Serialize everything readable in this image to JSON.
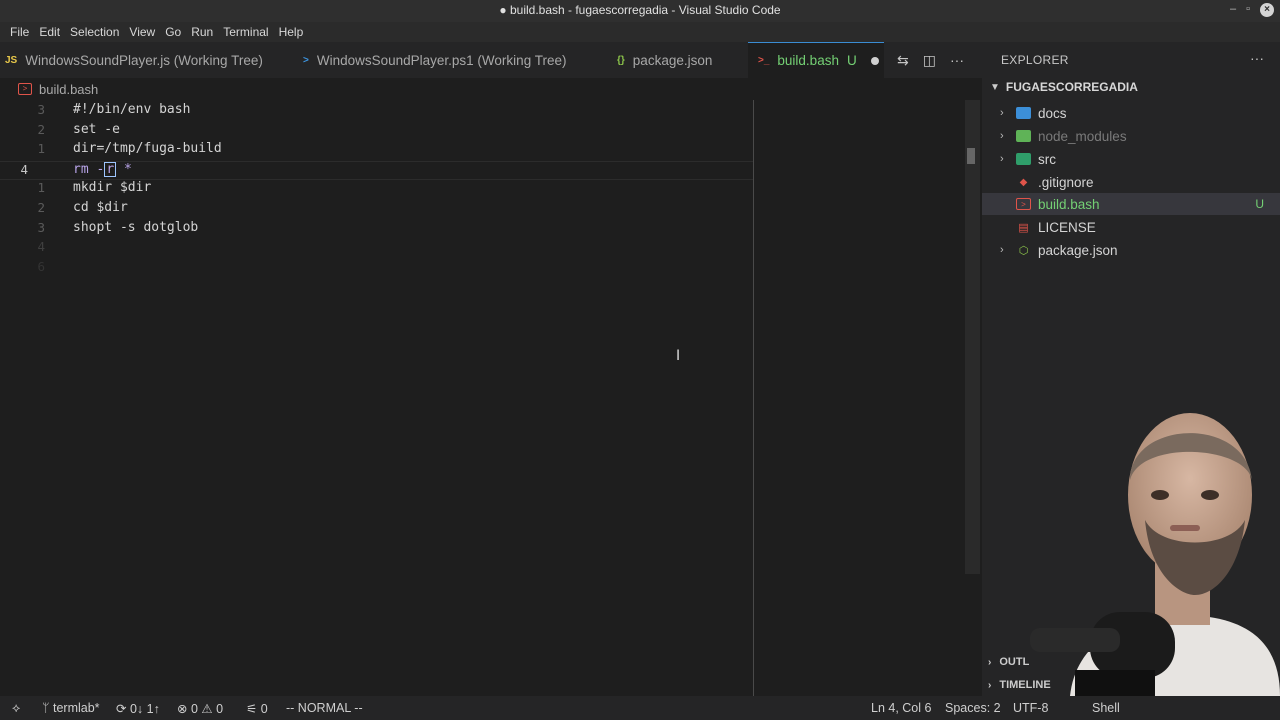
{
  "window": {
    "title": "● build.bash - fugaescorregadia - Visual Studio Code"
  },
  "menu": [
    "File",
    "Edit",
    "Selection",
    "View",
    "Go",
    "Run",
    "Terminal",
    "Help"
  ],
  "tabs": [
    {
      "label": "WindowsSoundPlayer.js (Working Tree)",
      "icon": "JS"
    },
    {
      "label": "WindowsSoundPlayer.ps1 (Working Tree)",
      "icon": ">"
    },
    {
      "label": "package.json",
      "icon": "{}"
    },
    {
      "label": "build.bash",
      "badge": "U",
      "icon": ">_"
    }
  ],
  "breadcrumb": {
    "file": "build.bash"
  },
  "editor": {
    "lines": [
      {
        "num": "3",
        "code": "#!/bin/env bash"
      },
      {
        "num": "2",
        "code": "set -e"
      },
      {
        "num": "1",
        "code": "dir=/tmp/fuga-build"
      },
      {
        "num": "4",
        "code": "rm -r *"
      },
      {
        "num": "1",
        "code": "mkdir $dir"
      },
      {
        "num": "2",
        "code": "cd $dir"
      },
      {
        "num": "3",
        "code": "shopt -s dotglob"
      },
      {
        "num": "4",
        "code": ""
      },
      {
        "num": "6",
        "code": ""
      }
    ]
  },
  "explorer": {
    "header": "EXPLORER",
    "project": "FUGAESCORREGADIA",
    "items": [
      {
        "label": "docs"
      },
      {
        "label": "node_modules"
      },
      {
        "label": "src"
      },
      {
        "label": ".gitignore"
      },
      {
        "label": "build.bash",
        "badge": "U"
      },
      {
        "label": "LICENSE"
      },
      {
        "label": "package.json"
      }
    ],
    "outline": "OUTL",
    "timeline": "TIMELINE"
  },
  "status": {
    "branch": "termlab*",
    "sync": "0↓ 1↑",
    "errors": "0",
    "warnings": "0",
    "info": "0",
    "mode": "-- NORMAL --",
    "position": "Ln 4, Col 6",
    "spaces": "Spaces: 2",
    "encoding": "UTF-8",
    "language": "Shell"
  },
  "colors": {
    "accent": "#3a8cd3",
    "git_untracked": "#74d074",
    "bash_icon": "#e0544a"
  }
}
